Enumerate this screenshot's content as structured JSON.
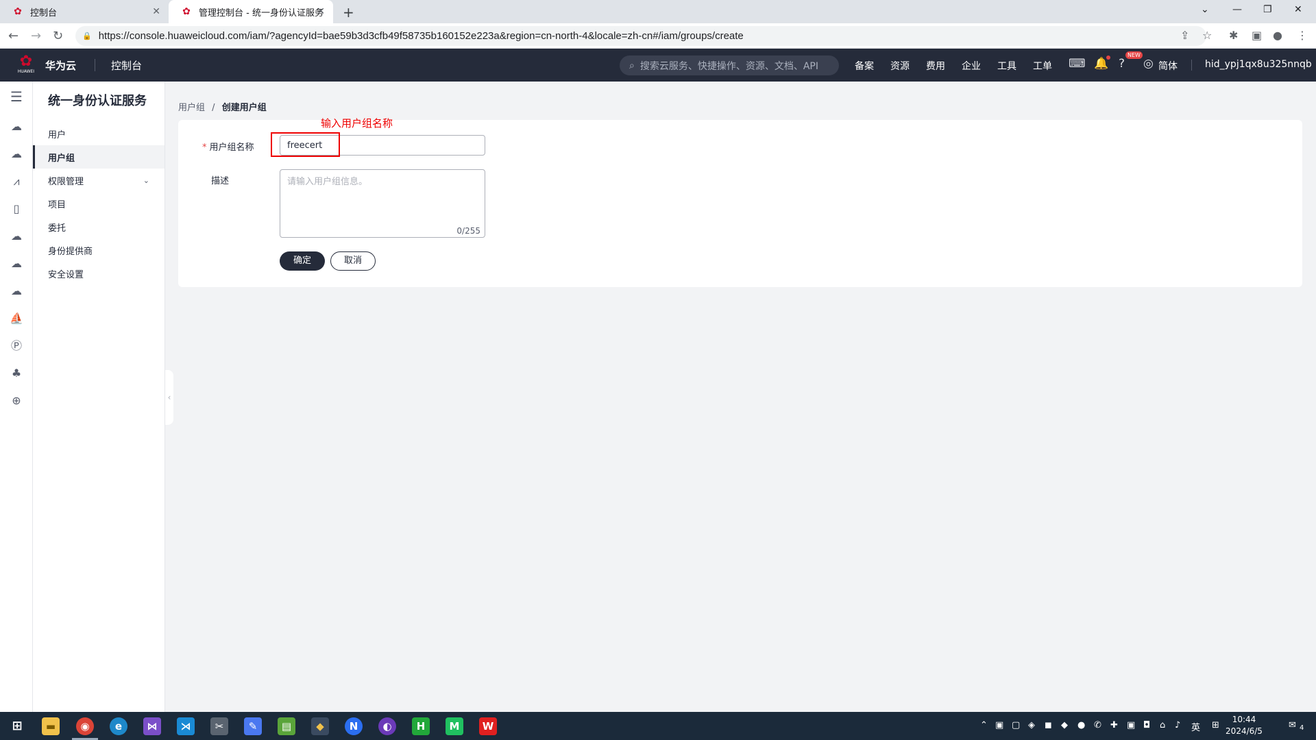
{
  "browser": {
    "tabs": [
      {
        "title": "控制台"
      },
      {
        "title": "管理控制台 - 统一身份认证服务"
      }
    ],
    "url": "https://console.huaweicloud.com/iam/?agencyId=bae59b3d3cfb49f58735b160152e223a&region=cn-north-4&locale=zh-cn#/iam/groups/create"
  },
  "topbar": {
    "logo_text": "HUAWEI",
    "brand": "华为云",
    "console": "控制台",
    "search_placeholder": "搜索云服务、快捷操作、资源、文档、API",
    "nav": [
      "备案",
      "资源",
      "费用",
      "企业",
      "工具",
      "工单"
    ],
    "new_badge": "NEW",
    "lang": "简体",
    "username": "hid_ypj1qx8u325nnqb"
  },
  "sidebar": {
    "title": "统一身份认证服务",
    "items": [
      {
        "label": "用户"
      },
      {
        "label": "用户组"
      },
      {
        "label": "权限管理"
      },
      {
        "label": "项目"
      },
      {
        "label": "委托"
      },
      {
        "label": "身份提供商"
      },
      {
        "label": "安全设置"
      }
    ],
    "active_index": 1
  },
  "breadcrumb": {
    "parent": "用户组",
    "sep": "/",
    "current": "创建用户组"
  },
  "form": {
    "name_label": "用户组名称",
    "name_required_mark": "*",
    "name_value": "freecert",
    "desc_label": "描述",
    "desc_placeholder": "请输入用户组信息。",
    "desc_count": "0/255",
    "ok_label": "确定",
    "cancel_label": "取消"
  },
  "annotation": {
    "text": "输入用户组名称",
    "color": "#ee0000"
  },
  "taskbar": {
    "time": "10:44",
    "date": "2024/6/5",
    "ime": "英",
    "notifications": "4"
  },
  "colors": {
    "topbar_bg": "#252b3a",
    "brand_red": "#cf0a2c",
    "primary_btn": "#252b3a"
  }
}
